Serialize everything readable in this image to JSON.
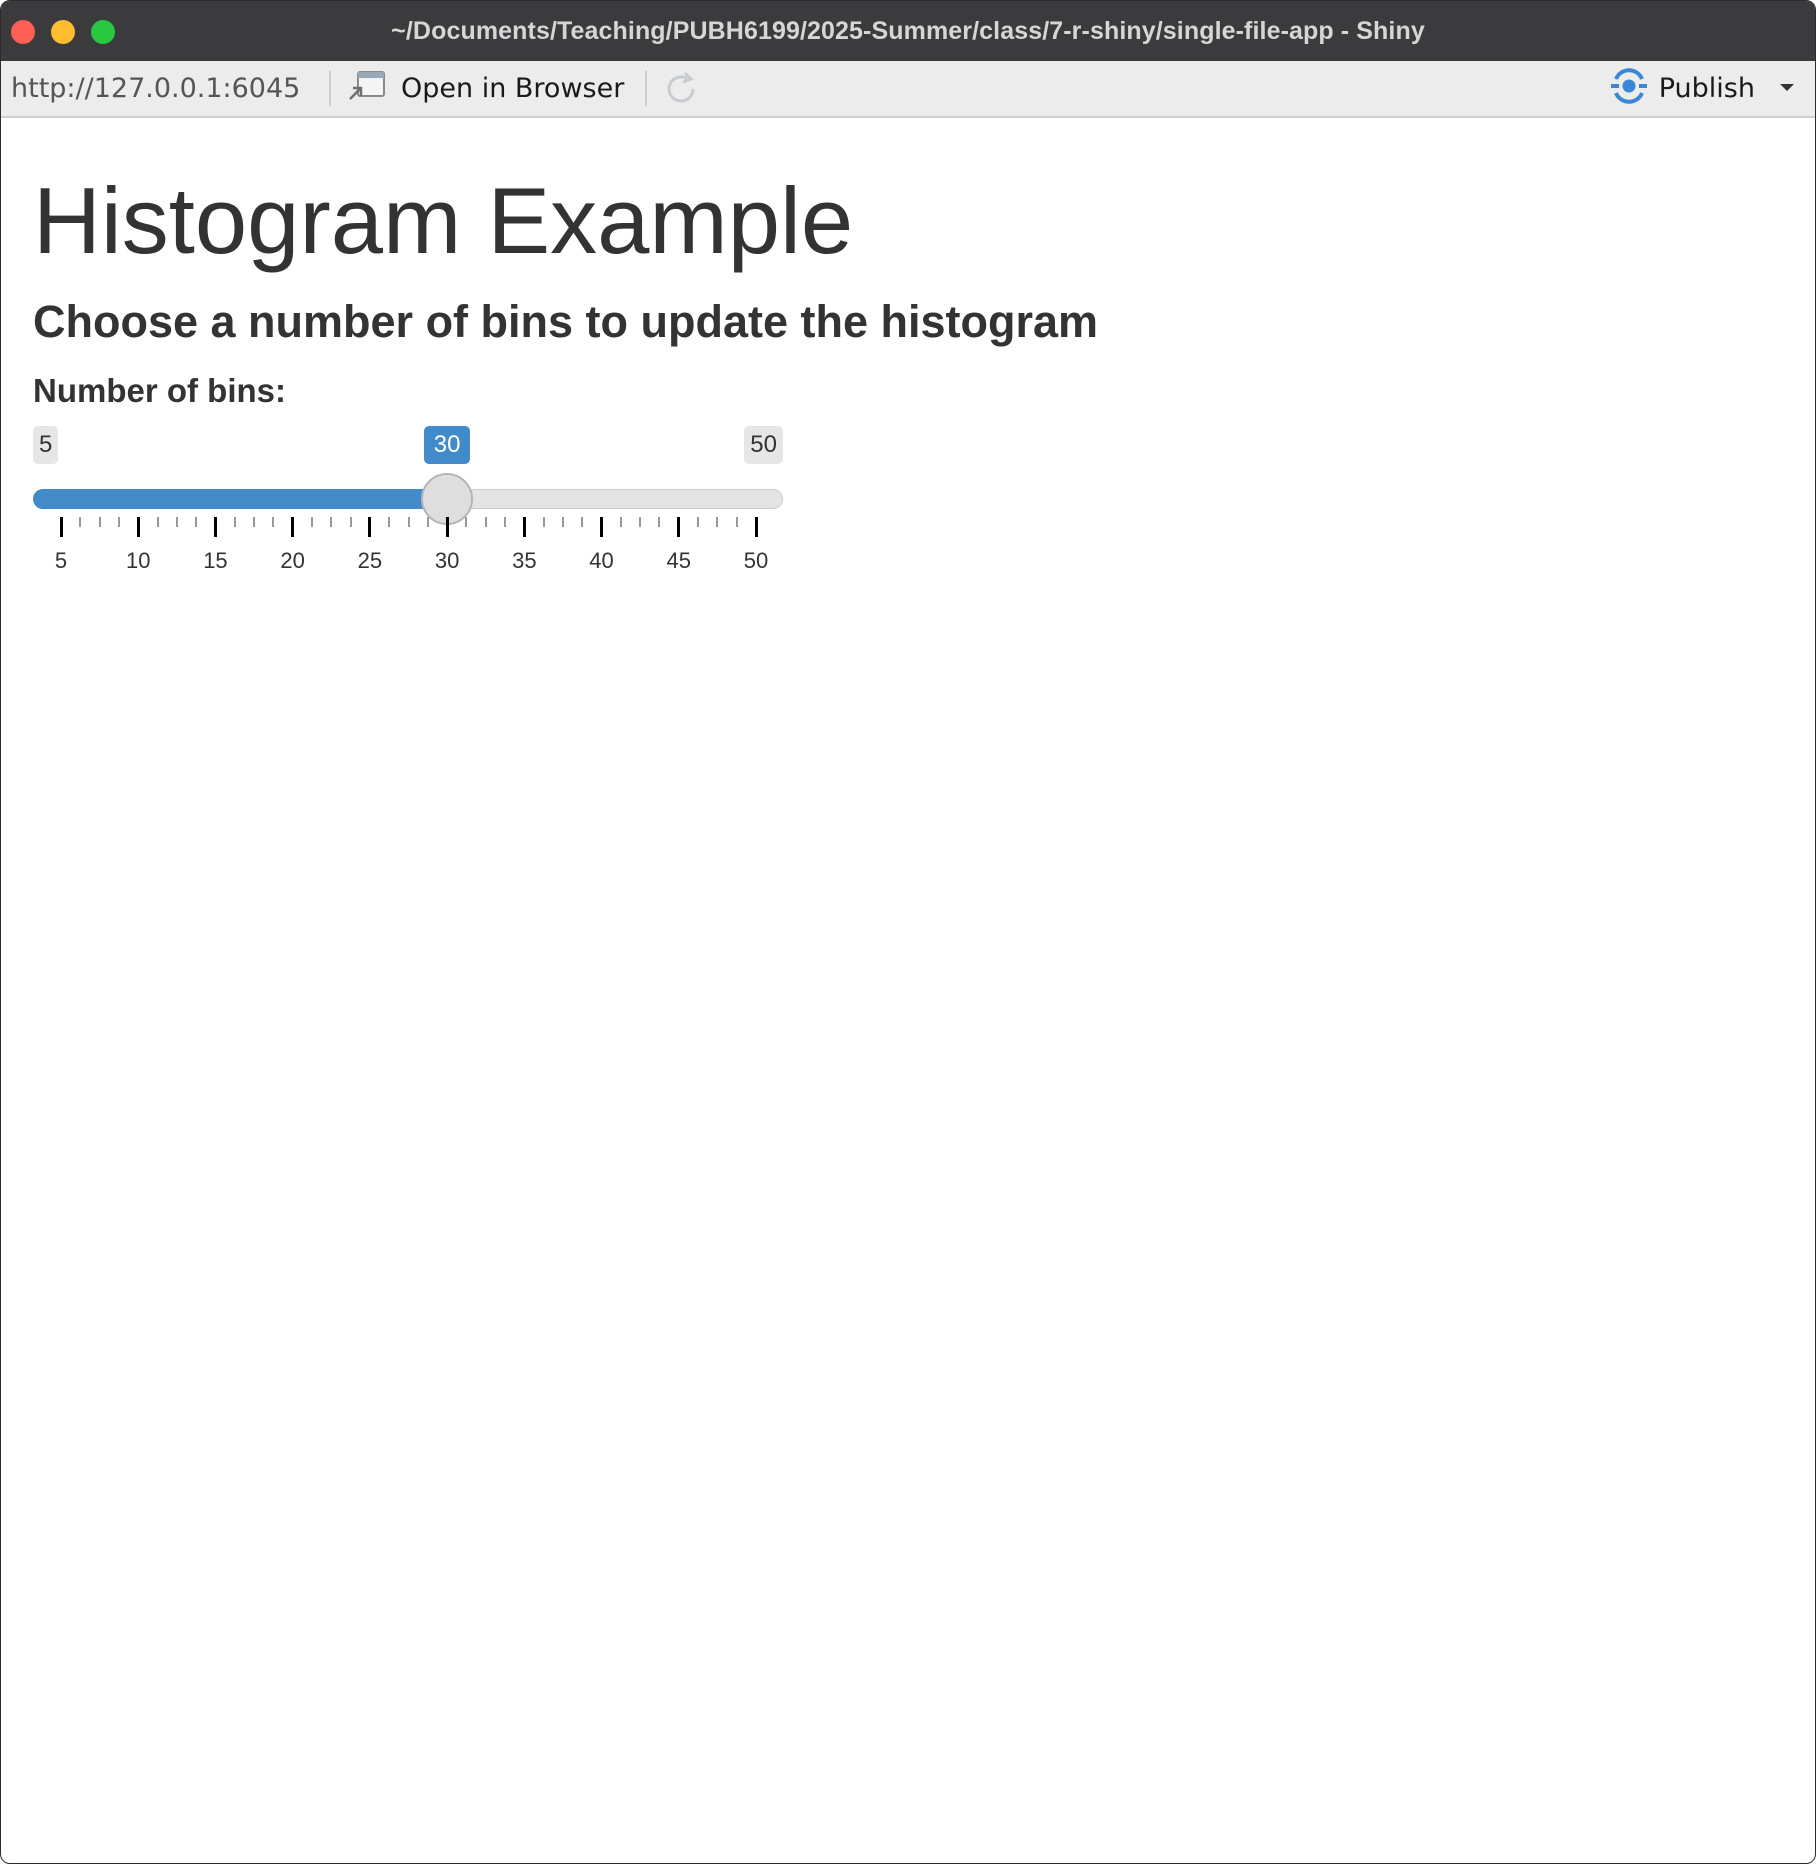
{
  "window": {
    "title": "~/Documents/Teaching/PUBH6199/2025-Summer/class/7-r-shiny/single-file-app - Shiny"
  },
  "toolbar": {
    "url": "http://127.0.0.1:6045",
    "open_in_browser_label": "Open in Browser",
    "publish_label": "Publish",
    "icons": {
      "open_in_browser": "open-in-browser-icon",
      "refresh": "refresh-icon",
      "publish": "publish-icon",
      "dropdown": "chevron-down-icon"
    },
    "publish_color": "#3b86d6"
  },
  "app": {
    "title": "Histogram Example",
    "subtitle": "Choose a number of bins to update the histogram",
    "slider": {
      "label": "Number of bins:",
      "min": 5,
      "max": 50,
      "value": 30,
      "min_label": "5",
      "max_label": "50",
      "value_label": "30",
      "tick_labels": [
        "5",
        "10",
        "15",
        "20",
        "25",
        "30",
        "35",
        "40",
        "45",
        "50"
      ],
      "accent_color": "#428bca"
    }
  }
}
